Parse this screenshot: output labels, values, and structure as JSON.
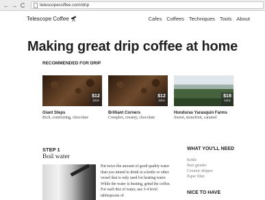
{
  "browser": {
    "url": "telescopecoffee.com/drip",
    "back": "←",
    "forward": "→",
    "reload": "C"
  },
  "header": {
    "logo": "Telescope Coffee",
    "nav": [
      "Cafes",
      "Coffees",
      "Techniques",
      "Tools",
      "About"
    ]
  },
  "hero": {
    "title": "Making great drip coffee at home"
  },
  "recommended": {
    "label": "RECOMMENDED FOR DRIP",
    "cards": [
      {
        "name": "Giant Steps",
        "desc": "Rich, comforting, chocolate",
        "price": "$12",
        "size": "12oz"
      },
      {
        "name": "Brilliant Corners",
        "desc": "Complex, creamy, chocolate",
        "price": "$12",
        "size": "12oz"
      },
      {
        "name": "Honduras Yarasquin Farms",
        "desc": "Sweet, stonefruit, caramel",
        "price": "$18",
        "size": "12oz"
      }
    ]
  },
  "step": {
    "label": "STEP 1",
    "title": "Boil water",
    "body": "Put twice the amount of good quality water than you intend to drink in a kettle or other vessel that is only used for heating water. While the water is heating, grind the coffee. For each 8oz of water, use 3-4 level tablespoons of"
  },
  "need": {
    "title": "WHAT YOU'LL NEED",
    "items": [
      "Kettle",
      "Burr grinder",
      "Ceramic dripper",
      "Paper filter"
    ],
    "nice_title": "NICE TO HAVE"
  }
}
